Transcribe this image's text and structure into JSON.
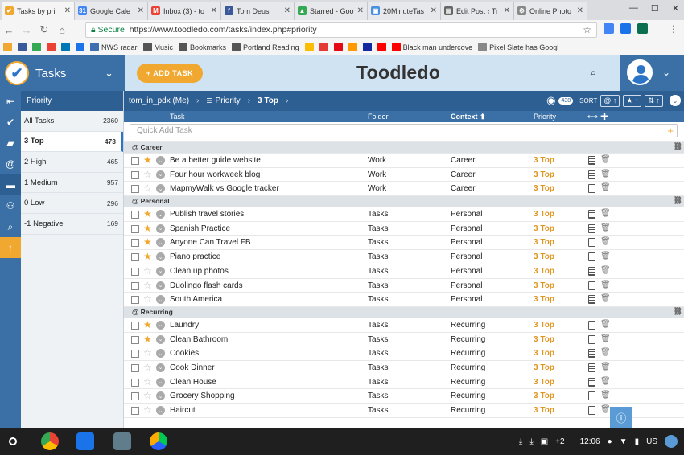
{
  "browser": {
    "tabs": [
      {
        "title": "Tasks by pri",
        "color": "#f0a830",
        "glyph": "✔",
        "active": true
      },
      {
        "title": "Google Cale",
        "color": "#4285f4",
        "glyph": "31",
        "active": false
      },
      {
        "title": "Inbox (3) - to",
        "color": "#ea4335",
        "glyph": "M",
        "active": false
      },
      {
        "title": "Tom Deus",
        "color": "#3b5998",
        "glyph": "f",
        "active": false
      },
      {
        "title": "Starred - Goo",
        "color": "#34a853",
        "glyph": "▲",
        "active": false
      },
      {
        "title": "20MinuteTas",
        "color": "#4a90e2",
        "glyph": "▣",
        "active": false
      },
      {
        "title": "Edit Post ‹ Tr",
        "color": "#666666",
        "glyph": "▤",
        "active": false
      },
      {
        "title": "Online Photo",
        "color": "#888888",
        "glyph": "⚙",
        "active": false
      }
    ],
    "secure_label": "Secure",
    "url": "https://www.toodledo.com/tasks/index.php#priority",
    "bookmarks": [
      {
        "label": "",
        "color": "#f0a830"
      },
      {
        "label": "",
        "color": "#3b5998"
      },
      {
        "label": "",
        "color": "#34a853"
      },
      {
        "label": "",
        "color": "#ea4335"
      },
      {
        "label": "",
        "color": "#0077b5"
      },
      {
        "label": "",
        "color": "#1a73e8"
      },
      {
        "label": "NWS radar",
        "color": "#3d6fb0"
      },
      {
        "label": "Music",
        "color": "#555555"
      },
      {
        "label": "Bookmarks",
        "color": "#555555"
      },
      {
        "label": "Portland Reading",
        "color": "#555555"
      },
      {
        "label": "",
        "color": "#fbbc04"
      },
      {
        "label": "",
        "color": "#e53935"
      },
      {
        "label": "",
        "color": "#e50914"
      },
      {
        "label": "",
        "color": "#ff9900"
      },
      {
        "label": "",
        "color": "#1428a0"
      },
      {
        "label": "",
        "color": "#ff0000"
      },
      {
        "label": "Black man undercove",
        "color": "#ff0000"
      },
      {
        "label": "Pixel Slate has Googl",
        "color": "#888888"
      }
    ]
  },
  "app": {
    "title": "Tasks",
    "add_task": "+ ADD TASK",
    "logo_text": "Toodledo",
    "user": "tom_in_pdx (Me)",
    "breadcrumb": [
      "Priority",
      "3 Top"
    ],
    "hidden_count": "438",
    "sort_label": "SORT"
  },
  "sidebar": {
    "header": "Priority",
    "items": [
      {
        "label": "All Tasks",
        "count": "2360",
        "selected": false
      },
      {
        "label": "3 Top",
        "count": "473",
        "selected": true
      },
      {
        "label": "2 High",
        "count": "465",
        "selected": false
      },
      {
        "label": "1 Medium",
        "count": "957",
        "selected": false
      },
      {
        "label": "0 Low",
        "count": "296",
        "selected": false
      },
      {
        "label": "-1 Negative",
        "count": "169",
        "selected": false
      }
    ]
  },
  "columns": {
    "task": "Task",
    "folder": "Folder",
    "context": "Context ⬆",
    "priority": "Priority"
  },
  "quick_add_placeholder": "Quick Add Task",
  "groups": [
    {
      "name": "Career",
      "tasks": [
        {
          "name": "Be a better guide website",
          "folder": "Work",
          "context": "Career",
          "priority": "3 Top",
          "star": true,
          "note": true
        },
        {
          "name": "Four hour workweek blog",
          "folder": "Work",
          "context": "Career",
          "priority": "3 Top",
          "star": false,
          "note": true
        },
        {
          "name": "MapmyWalk vs Google tracker",
          "folder": "Work",
          "context": "Career",
          "priority": "3 Top",
          "star": false,
          "note": false
        }
      ]
    },
    {
      "name": "Personal",
      "tasks": [
        {
          "name": "Publish travel stories",
          "folder": "Tasks",
          "context": "Personal",
          "priority": "3 Top",
          "star": true,
          "note": true
        },
        {
          "name": "Spanish Practice",
          "folder": "Tasks",
          "context": "Personal",
          "priority": "3 Top",
          "star": true,
          "note": true
        },
        {
          "name": "Anyone Can Travel FB",
          "folder": "Tasks",
          "context": "Personal",
          "priority": "3 Top",
          "star": true,
          "note": false
        },
        {
          "name": "Piano practice",
          "folder": "Tasks",
          "context": "Personal",
          "priority": "3 Top",
          "star": true,
          "note": false
        },
        {
          "name": "Clean up photos",
          "folder": "Tasks",
          "context": "Personal",
          "priority": "3 Top",
          "star": false,
          "note": true
        },
        {
          "name": "Duolingo flash cards",
          "folder": "Tasks",
          "context": "Personal",
          "priority": "3 Top",
          "star": false,
          "note": false
        },
        {
          "name": "South America",
          "folder": "Tasks",
          "context": "Personal",
          "priority": "3 Top",
          "star": false,
          "note": true
        }
      ]
    },
    {
      "name": "Recurring",
      "tasks": [
        {
          "name": "Laundry",
          "folder": "Tasks",
          "context": "Recurring",
          "priority": "3 Top",
          "star": true,
          "note": false
        },
        {
          "name": "Clean Bathroom",
          "folder": "Tasks",
          "context": "Recurring",
          "priority": "3 Top",
          "star": true,
          "note": false
        },
        {
          "name": "Cookies",
          "folder": "Tasks",
          "context": "Recurring",
          "priority": "3 Top",
          "star": false,
          "note": true
        },
        {
          "name": "Cook Dinner",
          "folder": "Tasks",
          "context": "Recurring",
          "priority": "3 Top",
          "star": false,
          "note": true
        },
        {
          "name": "Clean House",
          "folder": "Tasks",
          "context": "Recurring",
          "priority": "3 Top",
          "star": false,
          "note": true
        },
        {
          "name": "Grocery Shopping",
          "folder": "Tasks",
          "context": "Recurring",
          "priority": "3 Top",
          "star": false,
          "note": false
        },
        {
          "name": "Haircut",
          "folder": "Tasks",
          "context": "Recurring",
          "priority": "3 Top",
          "star": false,
          "note": false
        }
      ]
    }
  ],
  "shelf": {
    "time": "12:06",
    "locale": "US",
    "notif": "+2"
  }
}
